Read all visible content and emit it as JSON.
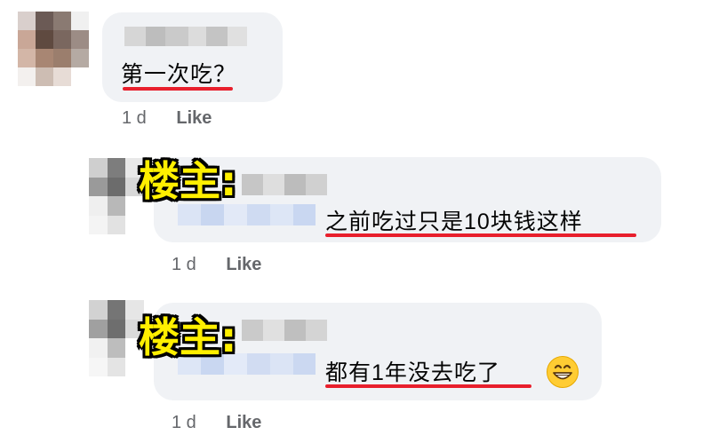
{
  "comments": [
    {
      "text": "第一次吃？",
      "time": "1 d",
      "like_label": "Like"
    },
    {
      "tag": "楼主:",
      "text": "之前吃过只是10块钱这样",
      "time": "1 d",
      "like_label": "Like"
    },
    {
      "tag": "楼主:",
      "text": "都有1年没去吃了",
      "emoji": "grinning-face-icon",
      "time": "1 d",
      "like_label": "Like"
    }
  ],
  "colors": {
    "bubble": "#f0f2f5",
    "underline": "#e81f2c",
    "tag_fill": "#ffef00",
    "meta": "#65676b"
  }
}
